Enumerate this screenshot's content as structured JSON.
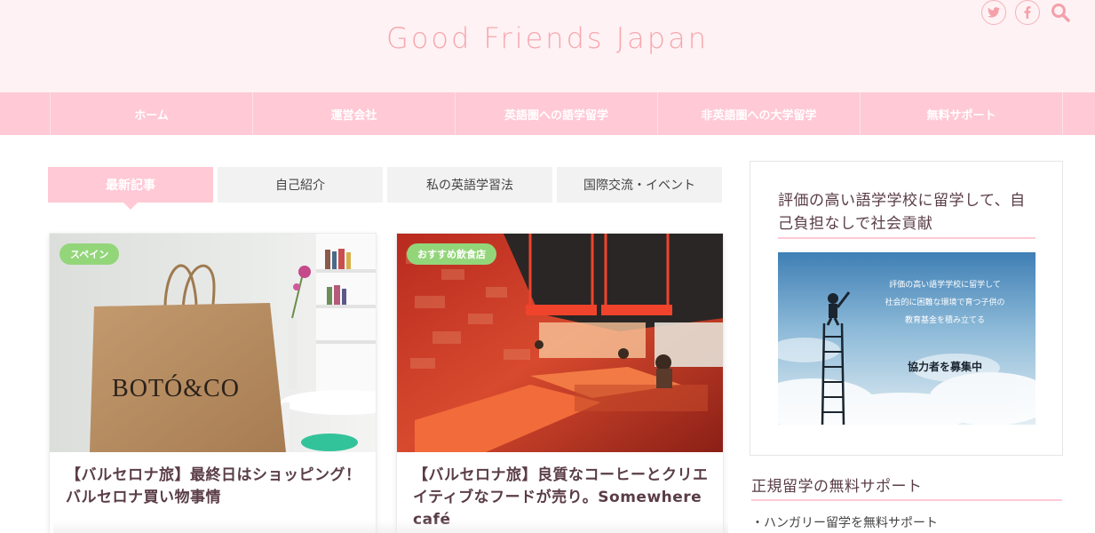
{
  "site": {
    "title": "Good Friends Japan"
  },
  "header_icons": [
    {
      "name": "twitter-icon",
      "glyph": "t"
    },
    {
      "name": "facebook-icon",
      "glyph": "f"
    }
  ],
  "nav": {
    "items": [
      {
        "label": "ホーム"
      },
      {
        "label": "運営会社"
      },
      {
        "label": "英語圏への語学留学"
      },
      {
        "label": "非英語圏への大学留学"
      },
      {
        "label": "無料サポート"
      }
    ]
  },
  "tabs": [
    {
      "label": "最新記事",
      "active": true
    },
    {
      "label": "自己紹介",
      "active": false
    },
    {
      "label": "私の英語学習法",
      "active": false
    },
    {
      "label": "国際交流・イベント",
      "active": false
    }
  ],
  "cards": [
    {
      "category": "スペイン",
      "title": "【バルセロナ旅】最終日はショッピング！バルセロナ買い物事情",
      "image_text": "BOTÓ&CO"
    },
    {
      "category": "おすすめ飲食店",
      "title": "【バルセロナ旅】良質なコーヒーとクリエイティブなフードが売り。Somewhere café"
    }
  ],
  "sidebar": {
    "widget_title": "評価の高い語学学校に留学して、自己負担なしで社会貢献",
    "banner_lines": [
      "評価の高い語学学校に留学して",
      "社会的に困難な環境で育つ子供の",
      "教育基金を積み立てる"
    ],
    "banner_cta": "協力者を募集中",
    "section_title": "正規留学の無料サポート",
    "links": [
      "・ハンガリー留学を無料サポート"
    ]
  },
  "colors": {
    "accent_pink": "#ffc9d5",
    "title_pink": "#f7a6ae",
    "header_bg": "#fef2f4",
    "badge_green": "#93d67a"
  }
}
